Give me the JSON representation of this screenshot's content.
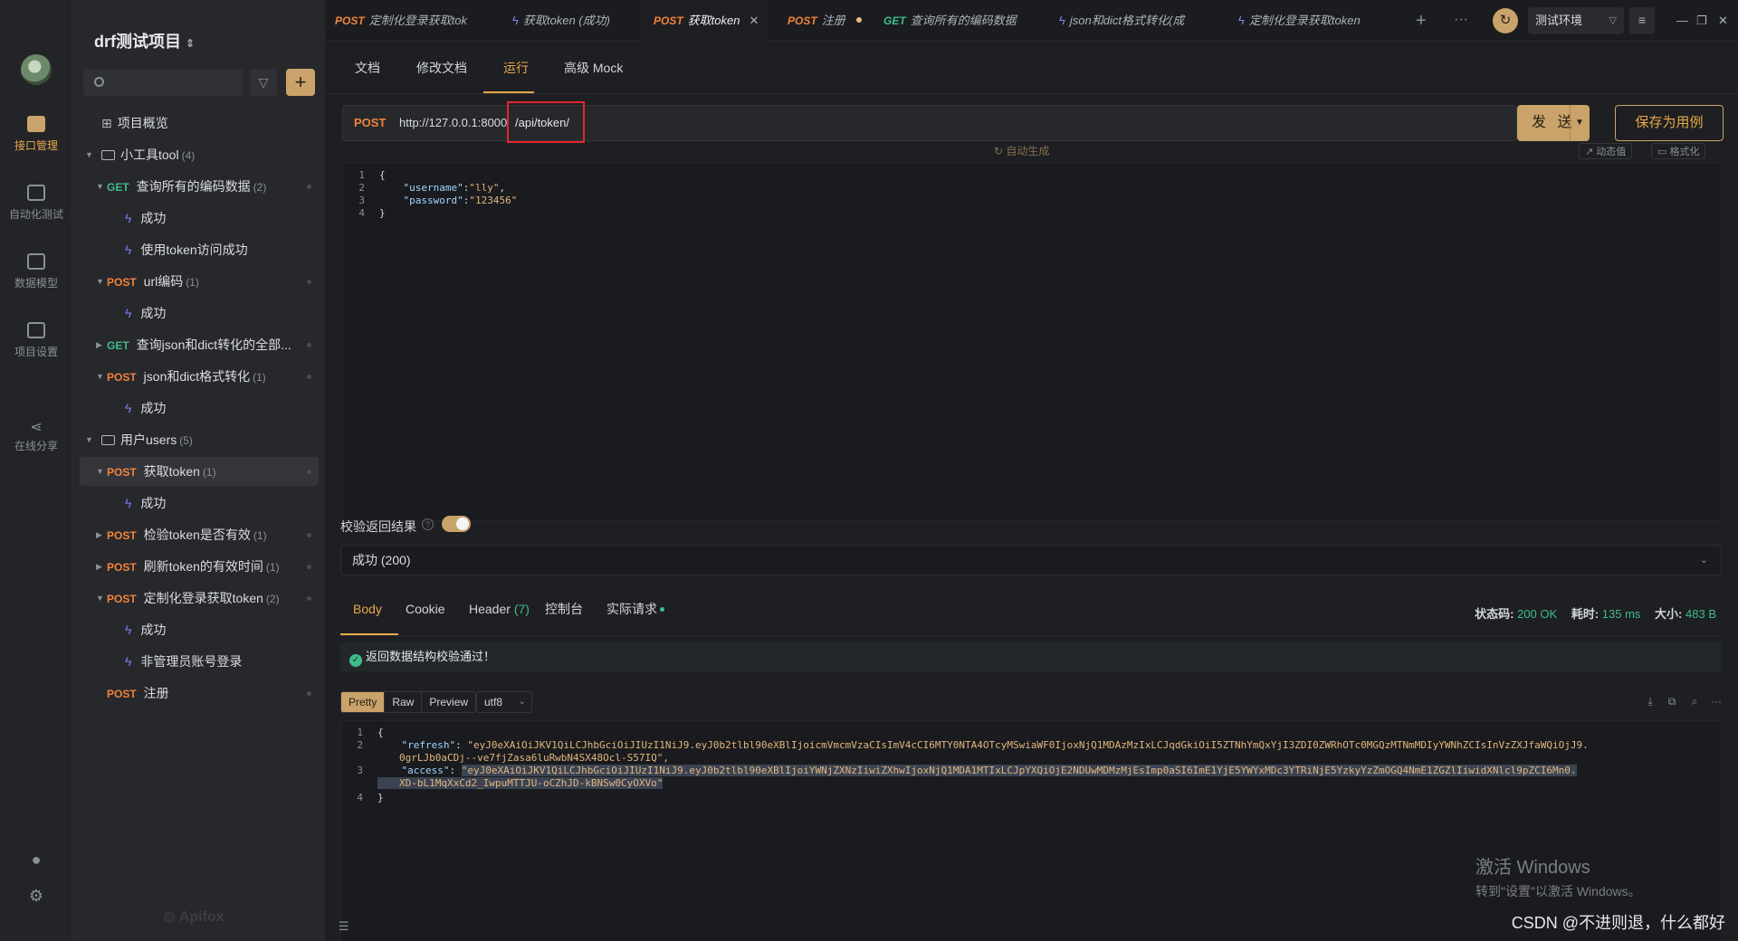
{
  "sidebar_rail": {
    "items": [
      {
        "label": "接口管理",
        "active": true
      },
      {
        "label": "自动化测试",
        "active": false
      },
      {
        "label": "数据模型",
        "active": false
      },
      {
        "label": "项目设置",
        "active": false
      },
      {
        "label": "在线分享",
        "active": false
      }
    ]
  },
  "tree": {
    "project_name": "drf测试项目",
    "project_chevron": "⌃⌄",
    "filter_icon": "▽",
    "add_icon": "+",
    "overview": "项目概览",
    "nodes": [
      {
        "type": "folder",
        "label": "小工具tool",
        "count": "(4)"
      },
      {
        "type": "api",
        "method": "GET",
        "label": "查询所有的编码数据",
        "count": "(2)"
      },
      {
        "type": "case",
        "label": "成功"
      },
      {
        "type": "case",
        "label": "使用token访问成功"
      },
      {
        "type": "api",
        "method": "POST",
        "label": "url编码",
        "count": "(1)"
      },
      {
        "type": "case",
        "label": "成功"
      },
      {
        "type": "api",
        "method": "GET",
        "label": "查询json和dict转化的全部...",
        "count": ""
      },
      {
        "type": "api",
        "method": "POST",
        "label": "json和dict格式转化",
        "count": "(1)"
      },
      {
        "type": "case",
        "label": "成功"
      },
      {
        "type": "folder",
        "label": "用户users",
        "count": "(5)"
      },
      {
        "type": "api",
        "method": "POST",
        "label": "获取token",
        "count": "(1)"
      },
      {
        "type": "case",
        "label": "成功"
      },
      {
        "type": "api",
        "method": "POST",
        "label": "检验token是否有效",
        "count": "(1)"
      },
      {
        "type": "api",
        "method": "POST",
        "label": "刷新token的有效时间",
        "count": "(1)"
      },
      {
        "type": "api",
        "method": "POST",
        "label": "定制化登录获取token",
        "count": "(2)"
      },
      {
        "type": "case",
        "label": "成功"
      },
      {
        "type": "case",
        "label": "非管理员账号登录"
      },
      {
        "type": "api",
        "method": "POST",
        "label": "注册",
        "count": ""
      }
    ],
    "brand": "Apifox"
  },
  "tabs": [
    {
      "method": "POST",
      "label": "定制化登录获取tok"
    },
    {
      "method": "",
      "label": "获取token (成功)"
    },
    {
      "method": "POST",
      "label": "获取token",
      "active": true
    },
    {
      "method": "POST",
      "label": "注册"
    },
    {
      "method": "GET",
      "label": "查询所有的编码数据"
    },
    {
      "method": "",
      "label": "json和dict格式转化(成"
    },
    {
      "method": "",
      "label": "定制化登录获取token"
    }
  ],
  "env": {
    "label": "测试环境"
  },
  "subtabs": [
    "文档",
    "修改文档",
    "运行",
    "高级 Mock"
  ],
  "request": {
    "method": "POST",
    "base_url": "http://127.0.0.1:8000",
    "path": "/api/token/",
    "send_label": "发 送",
    "save_label": "保存为用例",
    "auto_generate_hint": "自动生成",
    "dynamic_value_label": "动态值",
    "format_label": "格式化",
    "body_lines": [
      {
        "num": "1",
        "parts": [
          {
            "t": "{",
            "c": "p"
          }
        ]
      },
      {
        "num": "2",
        "parts": [
          {
            "t": "    ",
            "c": "p"
          },
          {
            "t": "\"username\"",
            "c": "k"
          },
          {
            "t": ":",
            "c": "p"
          },
          {
            "t": "\"lly\"",
            "c": "s"
          },
          {
            "t": ",",
            "c": "p"
          }
        ]
      },
      {
        "num": "3",
        "parts": [
          {
            "t": "    ",
            "c": "p"
          },
          {
            "t": "\"password\"",
            "c": "k"
          },
          {
            "t": ":",
            "c": "p"
          },
          {
            "t": "\"123456\"",
            "c": "s"
          }
        ]
      },
      {
        "num": "4",
        "parts": [
          {
            "t": "}",
            "c": "p"
          }
        ]
      }
    ]
  },
  "validation": {
    "label": "校验返回结果",
    "enabled": true,
    "selected": "成功 (200)"
  },
  "response": {
    "tabs": [
      "Body",
      "Cookie",
      "Header",
      "控制台",
      "实际请求"
    ],
    "header_count": "(7)",
    "status_label": "状态码:",
    "status_value": "200 OK",
    "time_label": "耗时:",
    "time_value": "135 ms",
    "size_label": "大小:",
    "size_value": "483 B",
    "pass_message": "返回数据结构校验通过！",
    "formats": [
      "Pretty",
      "Raw",
      "Preview"
    ],
    "encoding": "utf8",
    "lines": [
      {
        "num": "1",
        "text": "{"
      },
      {
        "num": "2",
        "key": "\"refresh\"",
        "value_a": "\"eyJ0eXAiOiJKV1QiLCJhbGciOiJIUzI1NiJ9.eyJ0b2tlbl90eXBlIjoicmVmcmVzaCIsImV4cCI6MTY0NTA4OTcyMSwiaWF0IjoxNjQ1MDAzMzIxLCJqdGkiOiI5ZTNhYmQxYjI3ZDI0ZWRhOTc0MGQzMTNmMDIyYWNhZCIsInVzZXJfaWQiOjJ9.",
        "value_b": "0grLJb0aCDj--ve7fjZasa6luRwbN4SX48Ocl-S57IQ\","
      },
      {
        "num": "3",
        "key": "\"access\"",
        "value_a": "\"eyJ0eXAiOiJKV1QiLCJhbGciOiJIUzI1NiJ9.eyJ0b2tlbl90eXBlIjoiYWNjZXNzIiwiZXhwIjoxNjQ1MDA1MTIxLCJpYXQiOjE2NDUwMDMzMjEsImp0aSI6ImE1YjE5YWYxMDc3YTRiNjE5YzkyYzZmOGQ4NmE1ZGZlIiwidXNlcl9pZCI6Mn0.",
        "value_b": "XD-bL1MqXxCd2_IwpuMTTJU-oCZhJD-kBNSw0CyOXVo\""
      },
      {
        "num": "4",
        "text": "}"
      }
    ]
  },
  "watermark": {
    "title": "激活 Windows",
    "subtitle": "转到\"设置\"以激活 Windows。"
  },
  "credit": "CSDN @不进则退，什么都好"
}
